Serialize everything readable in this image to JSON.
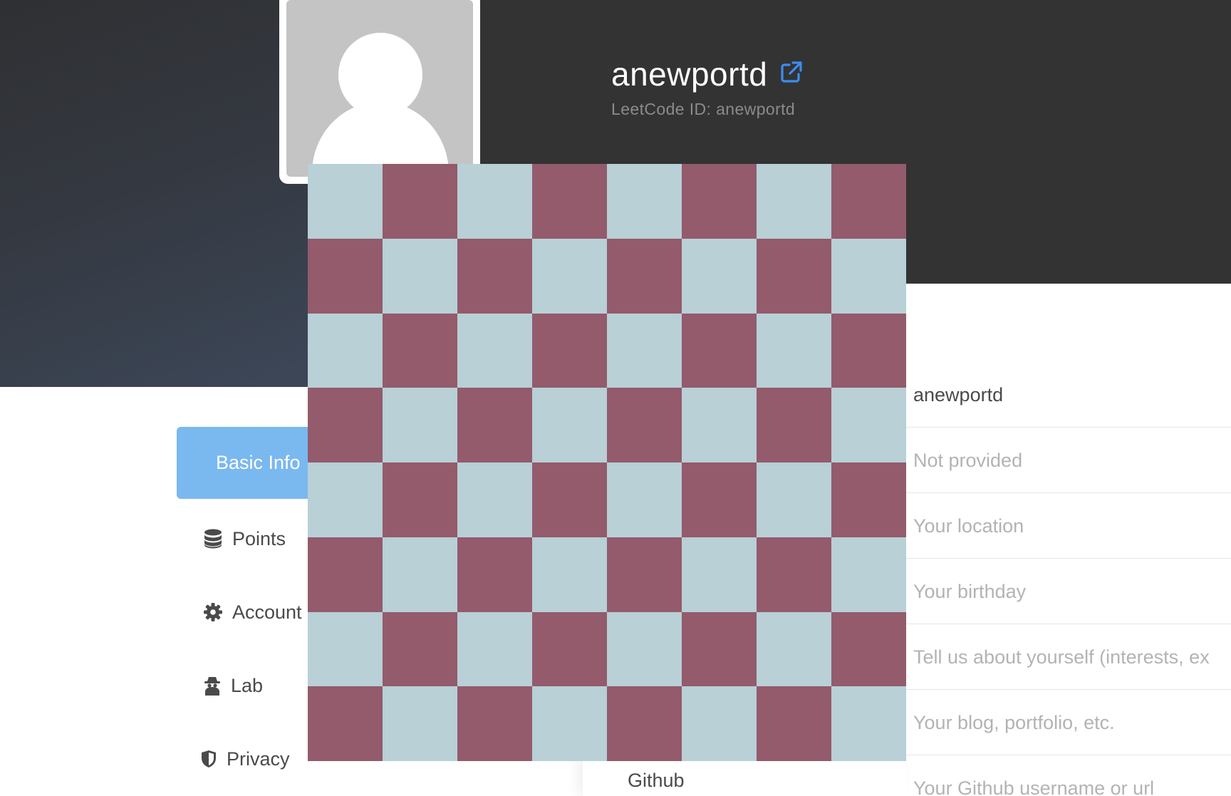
{
  "profile": {
    "username": "anewportd",
    "leetcode_id": "LeetCode ID: anewportd"
  },
  "sidebar": {
    "items": [
      {
        "label": "Basic Info",
        "icon": "user-icon",
        "active": true
      },
      {
        "label": "Points",
        "icon": "database-icon",
        "active": false
      },
      {
        "label": "Account",
        "icon": "gear-icon",
        "active": false
      },
      {
        "label": "Lab",
        "icon": "spy-icon",
        "active": false
      },
      {
        "label": "Privacy",
        "icon": "shield-icon",
        "active": false
      }
    ]
  },
  "form": {
    "fields": [
      {
        "value": "anewportd",
        "placeholder": ""
      },
      {
        "value": "",
        "placeholder": "Not provided"
      },
      {
        "value": "",
        "placeholder": "Your location"
      },
      {
        "value": "",
        "placeholder": "Your birthday"
      },
      {
        "value": "",
        "placeholder": "Tell us about yourself (interests, ex"
      },
      {
        "value": "",
        "placeholder": "Your blog, portfolio, etc."
      },
      {
        "value": "",
        "placeholder": "Your Github username or url"
      }
    ],
    "github_label": "Github"
  },
  "colors": {
    "accent": "#7ab8f0",
    "link_icon": "#3b8ef0",
    "checker_light": "#b8d0d6",
    "checker_dark": "#935b6c"
  }
}
